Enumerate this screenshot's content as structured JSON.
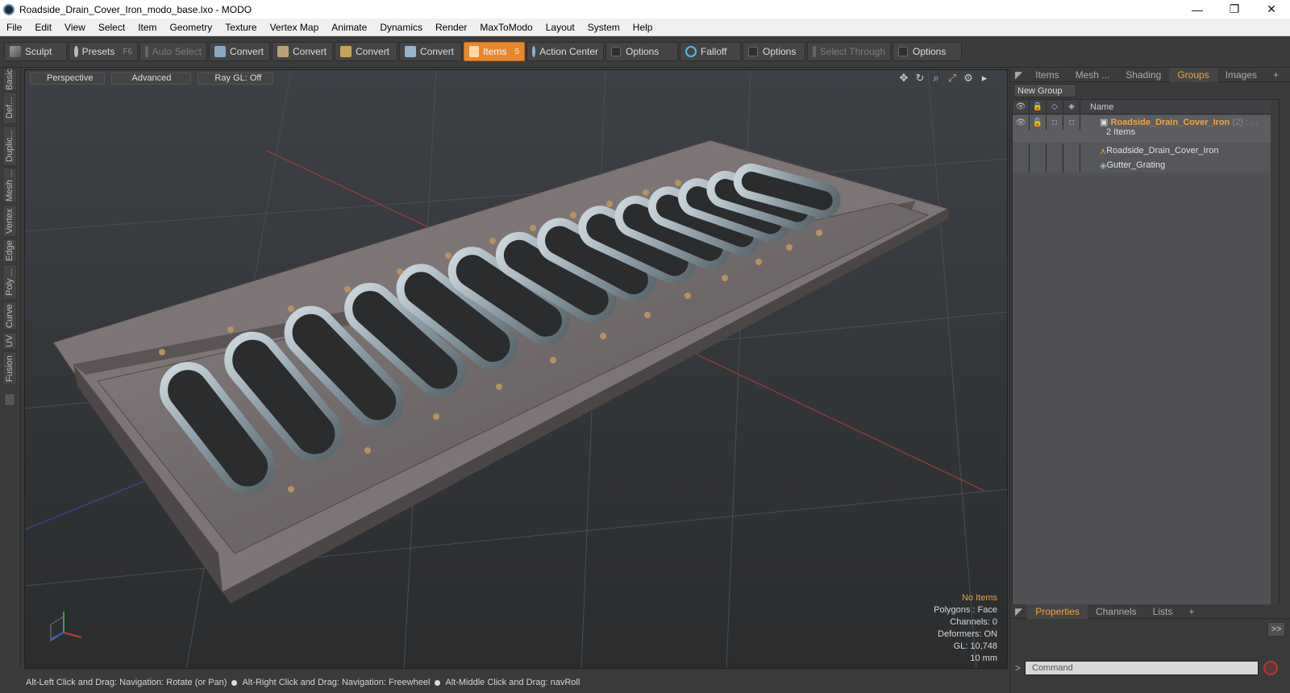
{
  "window": {
    "title": "Roadside_Drain_Cover_Iron_modo_base.lxo - MODO",
    "min": "—",
    "restore": "❐",
    "close": "✕"
  },
  "menu": [
    "File",
    "Edit",
    "View",
    "Select",
    "Item",
    "Geometry",
    "Texture",
    "Vertex Map",
    "Animate",
    "Dynamics",
    "Render",
    "MaxToModo",
    "Layout",
    "System",
    "Help"
  ],
  "toolbar": {
    "sculpt": "Sculpt",
    "presets": "Presets",
    "presets_key": "F6",
    "auto_select": "Auto Select",
    "convert1": "Convert",
    "convert2": "Convert",
    "convert3": "Convert",
    "convert4": "Convert",
    "items": "Items",
    "items_key": "5",
    "action_center": "Action Center",
    "options1": "Options",
    "falloff": "Falloff",
    "options2": "Options",
    "select_through": "Select Through",
    "options3": "Options"
  },
  "left_tabs": [
    "Basic",
    "Def...",
    "Duplic...",
    "Mesh ...",
    "Vertex",
    "Edge",
    "Poly ...",
    "Curve",
    "UV",
    "Fusion"
  ],
  "viewport": {
    "view": "Perspective",
    "style": "Advanced",
    "raygl": "Ray GL: Off",
    "stats": {
      "selection": "No Items",
      "polygons": "Polygons : Face",
      "channels": "Channels: 0",
      "deformers": "Deformers: ON",
      "gl": "GL: 10,748",
      "scale": "10 mm"
    }
  },
  "status": {
    "hint1": "Alt-Left Click and Drag: Navigation: Rotate (or Pan)",
    "hint2": "Alt-Right Click and Drag: Navigation: Freewheel",
    "hint3": "Alt-Middle Click and Drag: navRoll"
  },
  "right_panel": {
    "tabs": [
      "Items",
      "Mesh ...",
      "Shading",
      "Groups",
      "Images"
    ],
    "selected_tab": "Groups",
    "new_group": "New Group",
    "name_col": "Name",
    "group": {
      "name": "Roadside_Drain_Cover_Iron",
      "suffix": "(2) : ...",
      "count": "2 Items"
    },
    "children": [
      "Roadside_Drain_Cover_Iron",
      "Gutter_Grating"
    ],
    "bottom_tabs": [
      "Properties",
      "Channels",
      "Lists"
    ],
    "bottom_selected": "Properties",
    "expand": ">>",
    "command_placeholder": "Command"
  },
  "colors": {
    "accent": "#e8882d",
    "group_text": "#f1a23c",
    "viewport_bg": "#34373a"
  }
}
